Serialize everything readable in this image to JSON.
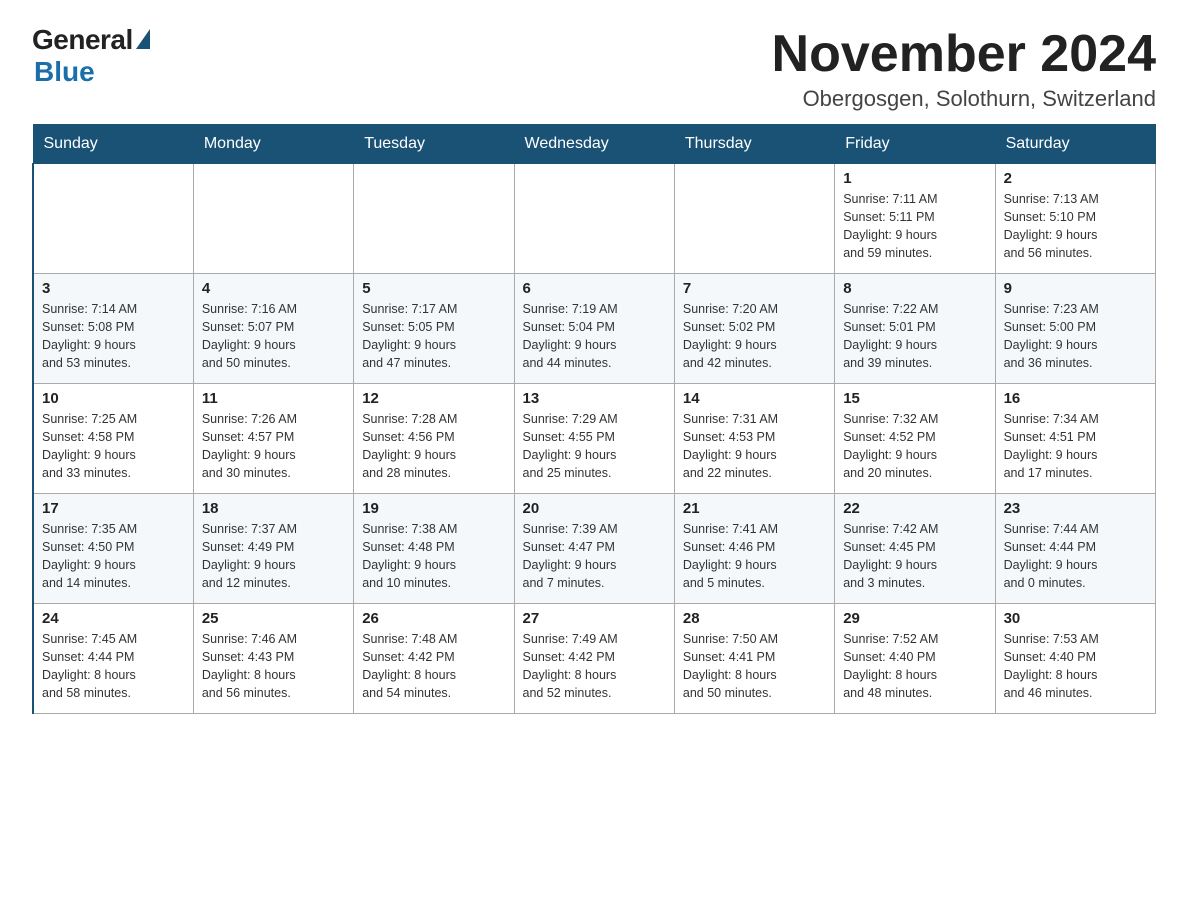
{
  "header": {
    "logo_general": "General",
    "logo_blue": "Blue",
    "month_title": "November 2024",
    "location": "Obergosgen, Solothurn, Switzerland"
  },
  "days_of_week": [
    "Sunday",
    "Monday",
    "Tuesday",
    "Wednesday",
    "Thursday",
    "Friday",
    "Saturday"
  ],
  "weeks": [
    [
      {
        "day": "",
        "info": ""
      },
      {
        "day": "",
        "info": ""
      },
      {
        "day": "",
        "info": ""
      },
      {
        "day": "",
        "info": ""
      },
      {
        "day": "",
        "info": ""
      },
      {
        "day": "1",
        "info": "Sunrise: 7:11 AM\nSunset: 5:11 PM\nDaylight: 9 hours\nand 59 minutes."
      },
      {
        "day": "2",
        "info": "Sunrise: 7:13 AM\nSunset: 5:10 PM\nDaylight: 9 hours\nand 56 minutes."
      }
    ],
    [
      {
        "day": "3",
        "info": "Sunrise: 7:14 AM\nSunset: 5:08 PM\nDaylight: 9 hours\nand 53 minutes."
      },
      {
        "day": "4",
        "info": "Sunrise: 7:16 AM\nSunset: 5:07 PM\nDaylight: 9 hours\nand 50 minutes."
      },
      {
        "day": "5",
        "info": "Sunrise: 7:17 AM\nSunset: 5:05 PM\nDaylight: 9 hours\nand 47 minutes."
      },
      {
        "day": "6",
        "info": "Sunrise: 7:19 AM\nSunset: 5:04 PM\nDaylight: 9 hours\nand 44 minutes."
      },
      {
        "day": "7",
        "info": "Sunrise: 7:20 AM\nSunset: 5:02 PM\nDaylight: 9 hours\nand 42 minutes."
      },
      {
        "day": "8",
        "info": "Sunrise: 7:22 AM\nSunset: 5:01 PM\nDaylight: 9 hours\nand 39 minutes."
      },
      {
        "day": "9",
        "info": "Sunrise: 7:23 AM\nSunset: 5:00 PM\nDaylight: 9 hours\nand 36 minutes."
      }
    ],
    [
      {
        "day": "10",
        "info": "Sunrise: 7:25 AM\nSunset: 4:58 PM\nDaylight: 9 hours\nand 33 minutes."
      },
      {
        "day": "11",
        "info": "Sunrise: 7:26 AM\nSunset: 4:57 PM\nDaylight: 9 hours\nand 30 minutes."
      },
      {
        "day": "12",
        "info": "Sunrise: 7:28 AM\nSunset: 4:56 PM\nDaylight: 9 hours\nand 28 minutes."
      },
      {
        "day": "13",
        "info": "Sunrise: 7:29 AM\nSunset: 4:55 PM\nDaylight: 9 hours\nand 25 minutes."
      },
      {
        "day": "14",
        "info": "Sunrise: 7:31 AM\nSunset: 4:53 PM\nDaylight: 9 hours\nand 22 minutes."
      },
      {
        "day": "15",
        "info": "Sunrise: 7:32 AM\nSunset: 4:52 PM\nDaylight: 9 hours\nand 20 minutes."
      },
      {
        "day": "16",
        "info": "Sunrise: 7:34 AM\nSunset: 4:51 PM\nDaylight: 9 hours\nand 17 minutes."
      }
    ],
    [
      {
        "day": "17",
        "info": "Sunrise: 7:35 AM\nSunset: 4:50 PM\nDaylight: 9 hours\nand 14 minutes."
      },
      {
        "day": "18",
        "info": "Sunrise: 7:37 AM\nSunset: 4:49 PM\nDaylight: 9 hours\nand 12 minutes."
      },
      {
        "day": "19",
        "info": "Sunrise: 7:38 AM\nSunset: 4:48 PM\nDaylight: 9 hours\nand 10 minutes."
      },
      {
        "day": "20",
        "info": "Sunrise: 7:39 AM\nSunset: 4:47 PM\nDaylight: 9 hours\nand 7 minutes."
      },
      {
        "day": "21",
        "info": "Sunrise: 7:41 AM\nSunset: 4:46 PM\nDaylight: 9 hours\nand 5 minutes."
      },
      {
        "day": "22",
        "info": "Sunrise: 7:42 AM\nSunset: 4:45 PM\nDaylight: 9 hours\nand 3 minutes."
      },
      {
        "day": "23",
        "info": "Sunrise: 7:44 AM\nSunset: 4:44 PM\nDaylight: 9 hours\nand 0 minutes."
      }
    ],
    [
      {
        "day": "24",
        "info": "Sunrise: 7:45 AM\nSunset: 4:44 PM\nDaylight: 8 hours\nand 58 minutes."
      },
      {
        "day": "25",
        "info": "Sunrise: 7:46 AM\nSunset: 4:43 PM\nDaylight: 8 hours\nand 56 minutes."
      },
      {
        "day": "26",
        "info": "Sunrise: 7:48 AM\nSunset: 4:42 PM\nDaylight: 8 hours\nand 54 minutes."
      },
      {
        "day": "27",
        "info": "Sunrise: 7:49 AM\nSunset: 4:42 PM\nDaylight: 8 hours\nand 52 minutes."
      },
      {
        "day": "28",
        "info": "Sunrise: 7:50 AM\nSunset: 4:41 PM\nDaylight: 8 hours\nand 50 minutes."
      },
      {
        "day": "29",
        "info": "Sunrise: 7:52 AM\nSunset: 4:40 PM\nDaylight: 8 hours\nand 48 minutes."
      },
      {
        "day": "30",
        "info": "Sunrise: 7:53 AM\nSunset: 4:40 PM\nDaylight: 8 hours\nand 46 minutes."
      }
    ]
  ]
}
